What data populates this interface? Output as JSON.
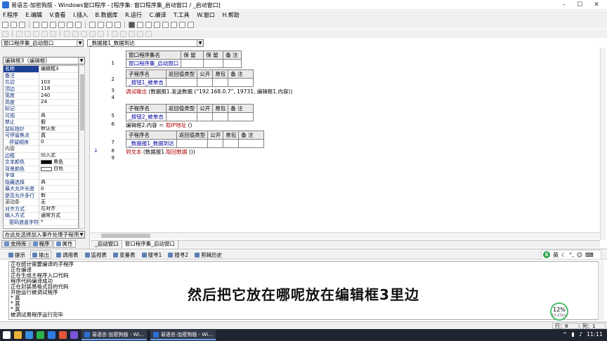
{
  "window": {
    "title": "易语言-加密狗版 - Windows窗口程序 - [程序集: 窗口程序集_启动窗口 / _启动窗口]",
    "minimize": "–",
    "maximize": "☐",
    "close": "✕"
  },
  "menu": [
    "F.程序",
    "E.编辑",
    "V.查看",
    "I.插入",
    "B.数据库",
    "R.运行",
    "C.编译",
    "T.工具",
    "W.窗口",
    "H.帮助"
  ],
  "combos": {
    "object": "窗口程序集_启动窗口",
    "method": "_数据报1_数据到达"
  },
  "property_panel": {
    "selected_object": "编辑框3（编辑框）",
    "rows": [
      {
        "name": "名称",
        "value": "编辑框3",
        "kind": "sel"
      },
      {
        "name": "备注",
        "value": ""
      },
      {
        "name": "左边",
        "value": "103"
      },
      {
        "name": "顶边",
        "value": "118"
      },
      {
        "name": "宽度",
        "value": "240"
      },
      {
        "name": "高度",
        "value": "24"
      },
      {
        "name": "标记",
        "value": ""
      },
      {
        "name": "可视",
        "value": "真"
      },
      {
        "name": "禁止",
        "value": "假"
      },
      {
        "name": "鼠标指针",
        "value": "默认型"
      },
      {
        "name": "可停留焦点",
        "value": "真"
      },
      {
        "name": "停留顺序",
        "value": "0",
        "kind": "sub"
      },
      {
        "name": "内容",
        "value": "",
        "kind": "grp"
      },
      {
        "name": "边框",
        "value": "凹入式"
      },
      {
        "name": "文本颜色",
        "value": "黑色",
        "swatch": "#000000"
      },
      {
        "name": "背景颜色",
        "value": "白色",
        "swatch": "#ffffff"
      },
      {
        "name": "字体",
        "value": ""
      },
      {
        "name": "隐藏选择",
        "value": "真"
      },
      {
        "name": "最大允许长度",
        "value": "0"
      },
      {
        "name": "是否允许多行",
        "value": "假"
      },
      {
        "name": "滚动条",
        "value": "无",
        "kind": "grp"
      },
      {
        "name": "对齐方式",
        "value": "左对齐"
      },
      {
        "name": "输入方式",
        "value": "通常方式"
      },
      {
        "name": "密码遮盖字符",
        "value": "*",
        "kind": "sub"
      }
    ],
    "event_combo": "在此处选择加入事件处理子程序"
  },
  "left_tabs": [
    "支持库",
    "程序",
    "属性"
  ],
  "editor": {
    "line_numbers": [
      "1",
      "2",
      "3",
      "4",
      "5",
      "6",
      "7",
      "8",
      "9"
    ],
    "assembly_header": [
      "窗口程序集名",
      "保 留",
      "保 留",
      "备 注"
    ],
    "assembly_name": "窗口程序集_启动窗口",
    "sub_header": [
      "子程序名",
      "返回值类型",
      "公开",
      "易包",
      "备 注"
    ],
    "subs": [
      "_按钮1_被单击",
      "_按钮2_被单击",
      "_数据报1_数据到达"
    ],
    "code": {
      "line3_call": "调试输出",
      "line3_text": " (数据报1.发送数据 (“192.168.0.7”, 19731, 编辑框1.内容))",
      "line6_text": "编辑框2.内容 ＝ ",
      "line6_fn": "取IP地址",
      "line6_tail": " ()",
      "line8_call": "到文本",
      "line8_text": " (数据报1.",
      "line8_fn": "取回数据",
      "line8_tail": " ())"
    },
    "arrow": "↓"
  },
  "editor_tabs": [
    "_启动窗口",
    "窗口程序集_启动窗口"
  ],
  "bottom_tabs": [
    "提示",
    "输出",
    "调用表",
    "监视表",
    "变量表",
    "搜寻1",
    "搜寻2",
    "剪辑历史"
  ],
  "output_lines": [
    "正在统计需要编译的子程序",
    "正在编译",
    "正在生成主程序入口代码",
    "程序代码编译成功",
    "正在封装易格式目的代码",
    "开始运行被调试程序",
    "* 真",
    "* 真",
    "* 真",
    "被调试易程序运行完毕"
  ],
  "subtitle": "然后把它放在哪呢放在编辑框3里边",
  "ime": {
    "lang": "英",
    "s": "S"
  },
  "cpu": {
    "percent": "12%",
    "speed": "10.03K/s"
  },
  "status": {
    "row": "行：8",
    "col": "列：1"
  },
  "taskbar": {
    "task1": "易语言-加密狗版 - Wi...",
    "task2": "易语言-加密狗版 - Wi...",
    "time": "11:11"
  }
}
